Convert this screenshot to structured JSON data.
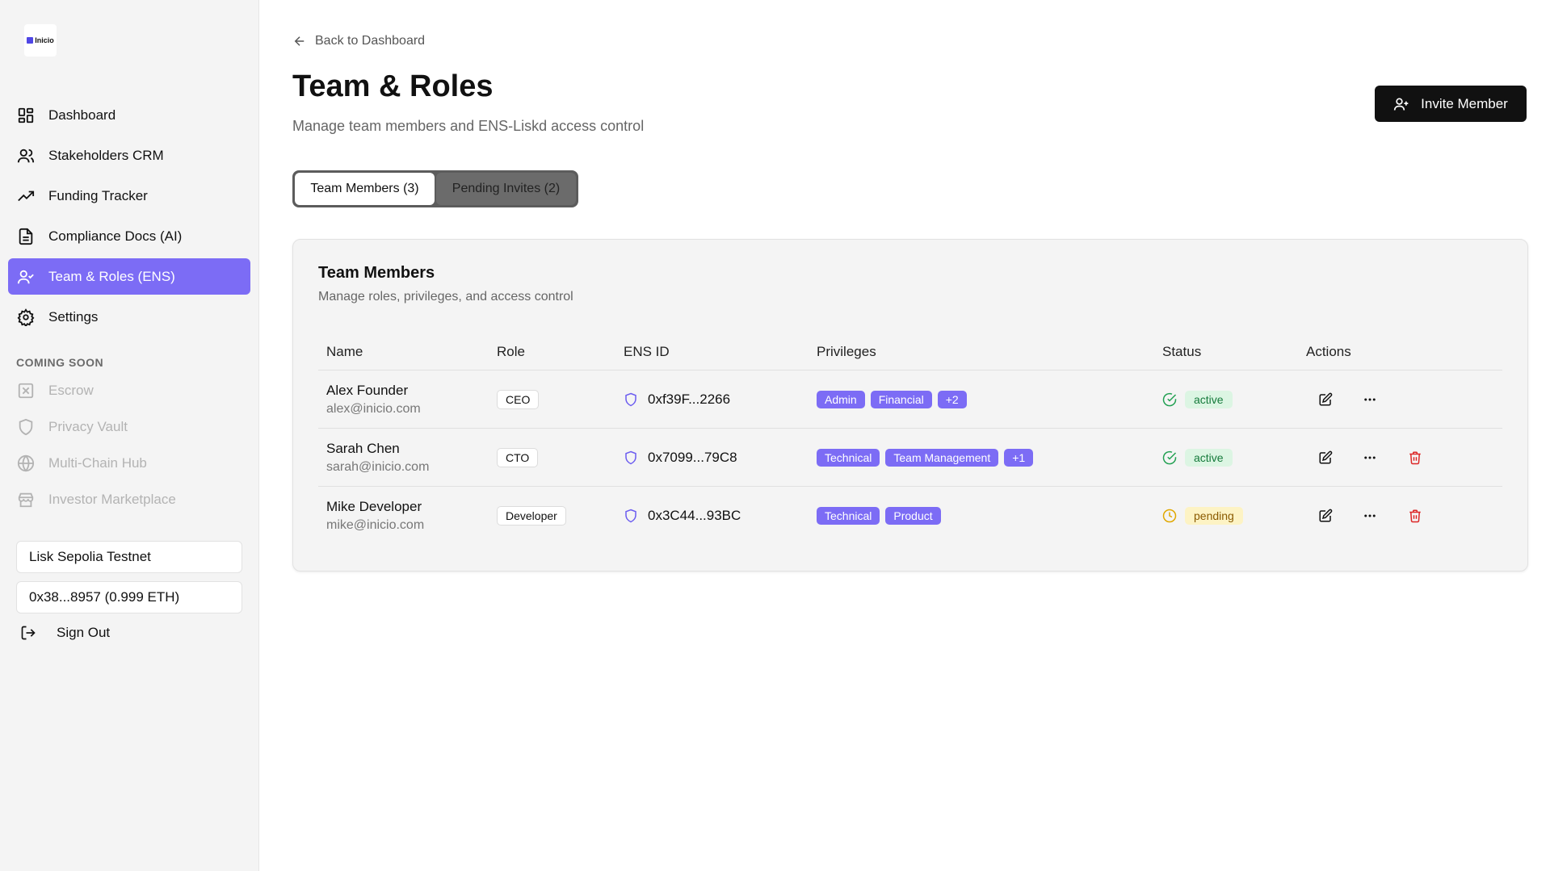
{
  "sidebar": {
    "logo_text": "Inicio",
    "nav": [
      {
        "label": "Dashboard",
        "icon": "dashboard-icon",
        "active": false
      },
      {
        "label": "Stakeholders CRM",
        "icon": "users-icon",
        "active": false
      },
      {
        "label": "Funding Tracker",
        "icon": "trending-up-icon",
        "active": false
      },
      {
        "label": "Compliance Docs (AI)",
        "icon": "document-icon",
        "active": false
      },
      {
        "label": "Team & Roles (ENS)",
        "icon": "user-check-icon",
        "active": true
      },
      {
        "label": "Settings",
        "icon": "gear-icon",
        "active": false
      }
    ],
    "coming_soon_label": "COMING SOON",
    "coming_soon": [
      {
        "label": "Escrow",
        "icon": "escrow-icon"
      },
      {
        "label": "Privacy Vault",
        "icon": "shield-icon"
      },
      {
        "label": "Multi-Chain Hub",
        "icon": "globe-icon"
      },
      {
        "label": "Investor Marketplace",
        "icon": "store-icon"
      }
    ],
    "network": "Lisk Sepolia Testnet",
    "wallet": "0x38...8957 (0.999 ETH)",
    "sign_out": "Sign Out"
  },
  "header": {
    "back": "Back to Dashboard",
    "title": "Team & Roles",
    "subtitle": "Manage team members and ENS-Liskd access control",
    "invite_button": "Invite Member"
  },
  "tabs": [
    {
      "label": "Team Members (3)",
      "active": true
    },
    {
      "label": "Pending Invites (2)",
      "active": false
    }
  ],
  "card": {
    "title": "Team Members",
    "subtitle": "Manage roles, privileges, and access control"
  },
  "table": {
    "columns": [
      "Name",
      "Role",
      "ENS ID",
      "Privileges",
      "Status",
      "Actions"
    ],
    "rows": [
      {
        "name": "Alex Founder",
        "email": "alex@inicio.com",
        "role": "CEO",
        "ens": "0xf39F...2266",
        "privileges": [
          "Admin",
          "Financial",
          "+2"
        ],
        "status": "active",
        "deletable": false
      },
      {
        "name": "Sarah Chen",
        "email": "sarah@inicio.com",
        "role": "CTO",
        "ens": "0x7099...79C8",
        "privileges": [
          "Technical",
          "Team Management",
          "+1"
        ],
        "status": "active",
        "deletable": true
      },
      {
        "name": "Mike Developer",
        "email": "mike@inicio.com",
        "role": "Developer",
        "ens": "0x3C44...93BC",
        "privileges": [
          "Technical",
          "Product"
        ],
        "status": "pending",
        "deletable": true
      }
    ]
  },
  "colors": {
    "accent": "#7c6cf5",
    "active_green": "#22a052",
    "pending_amber": "#e0a800",
    "delete_red": "#dc2626"
  }
}
